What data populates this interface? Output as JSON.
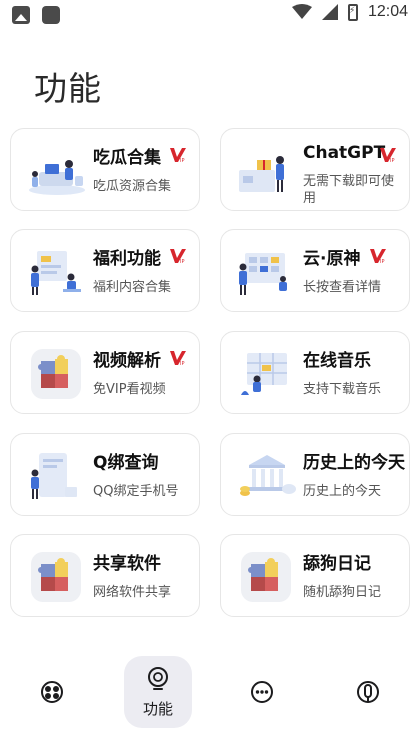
{
  "status": {
    "time": "12:04"
  },
  "page_title": "功能",
  "cards": [
    {
      "title": "吃瓜合集",
      "subtitle": "吃瓜资源合集",
      "vip": true,
      "illustration": "people-laptop-illustration"
    },
    {
      "title": "ChatGPT",
      "subtitle": "无需下载即可使用",
      "vip": true,
      "illustration": "gift-delivery-illustration"
    },
    {
      "title": "福利功能",
      "subtitle": "福利内容合集",
      "vip": true,
      "illustration": "team-dashboard-illustration"
    },
    {
      "title": "云·原神",
      "subtitle": "长按查看详情",
      "vip": true,
      "illustration": "calendar-planning-illustration"
    },
    {
      "title": "视频解析",
      "subtitle": "免VIP看视频",
      "vip": true,
      "illustration": "puzzle-icon"
    },
    {
      "title": "在线音乐",
      "subtitle": "支持下载音乐",
      "vip": false,
      "illustration": "schedule-board-illustration"
    },
    {
      "title": "Q绑查询",
      "subtitle": "QQ绑定手机号",
      "vip": false,
      "illustration": "phone-search-illustration"
    },
    {
      "title": "历史上的今天",
      "subtitle": "历史上的今天",
      "vip": false,
      "illustration": "bank-building-illustration"
    },
    {
      "title": "共享软件",
      "subtitle": "网络软件共享",
      "vip": false,
      "illustration": "puzzle-icon"
    },
    {
      "title": "舔狗日记",
      "subtitle": "随机舔狗日记",
      "vip": false,
      "illustration": "puzzle-icon"
    }
  ],
  "nav": {
    "items": [
      {
        "name": "nav-home",
        "icon": "aperture-icon",
        "label": ""
      },
      {
        "name": "nav-features",
        "icon": "lightbulb-icon",
        "label": "功能",
        "active": true
      },
      {
        "name": "nav-more",
        "icon": "more-dots-icon",
        "label": ""
      },
      {
        "name": "nav-profile",
        "icon": "profile-icon",
        "label": ""
      }
    ]
  },
  "colors": {
    "vip_red": "#d7262d",
    "nav_active_bg": "#ececf2",
    "illustration_blue": "#3f6fd6",
    "puzzle_red": "#b54a4a",
    "puzzle_yellow": "#f2cf5b"
  }
}
